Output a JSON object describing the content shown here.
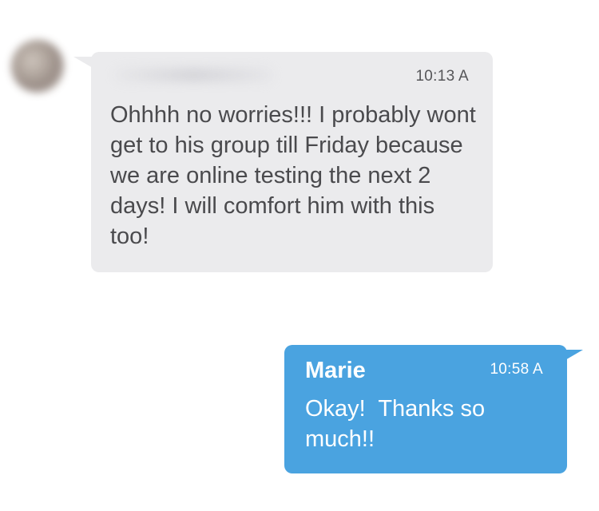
{
  "messages": {
    "incoming": {
      "time": "10:13 A",
      "text": "Ohhhh no worries!!! I probably wont get to his group till Friday because we are online testing the next 2 days! I will comfort him with this too!"
    },
    "outgoing": {
      "sender": "Marie",
      "time": "10:58 A",
      "text": "Okay!  Thanks so much!!"
    }
  },
  "colors": {
    "incoming_bubble": "#ebebed",
    "outgoing_bubble": "#4aa3e0",
    "incoming_text": "#4a4a4d",
    "outgoing_text": "#ffffff"
  },
  "icons": {
    "avatar": "contact-avatar"
  }
}
